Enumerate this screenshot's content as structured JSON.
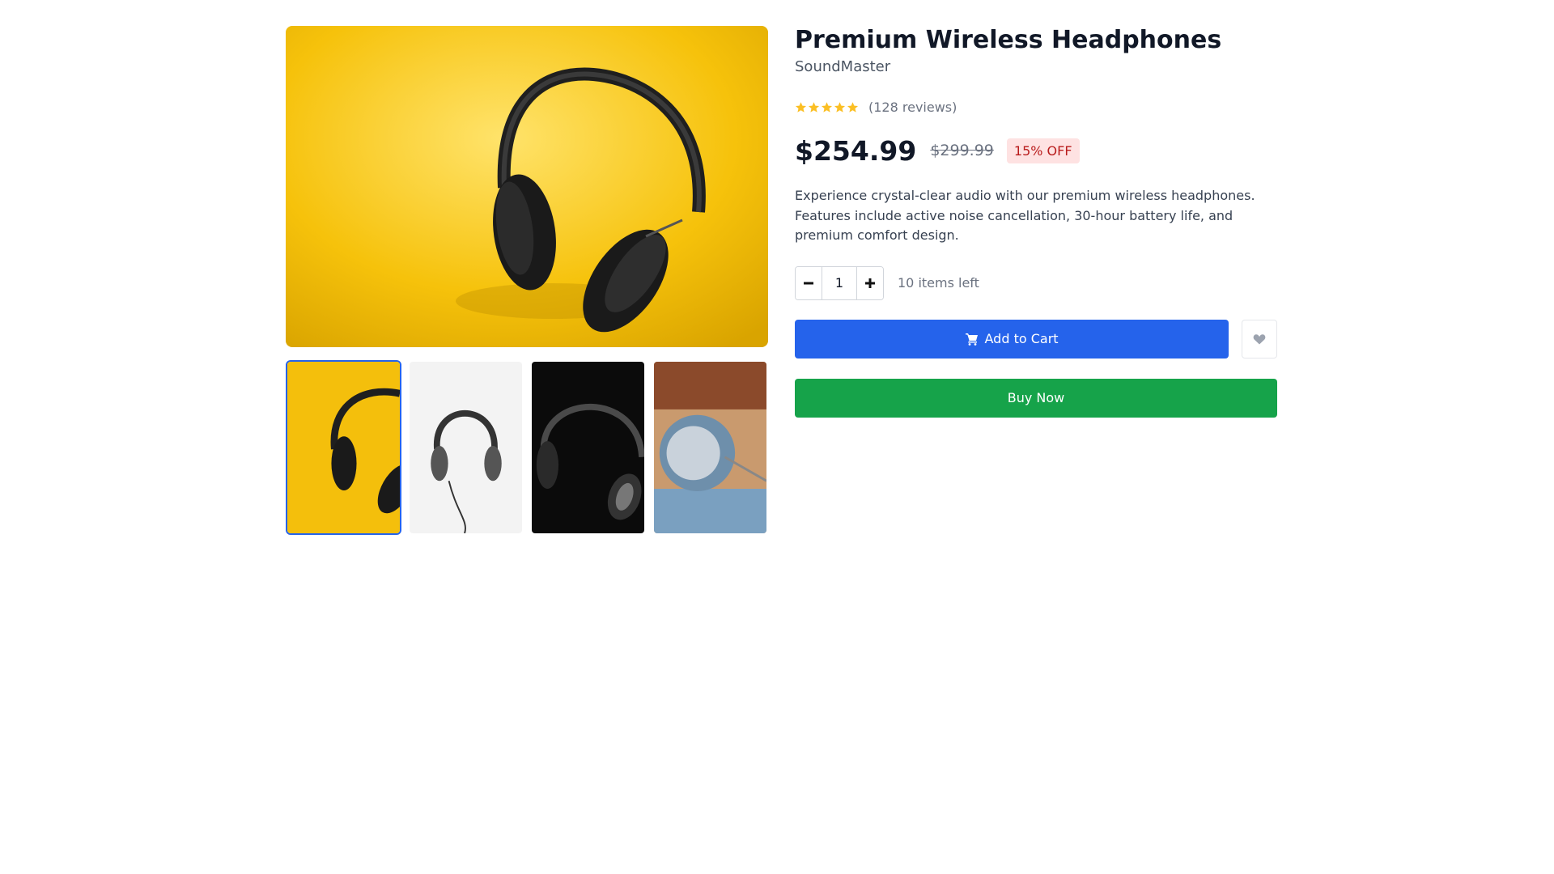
{
  "product": {
    "title": "Premium Wireless Headphones",
    "brand": "SoundMaster",
    "rating": 4.5,
    "rating_max": 5,
    "reviews_label": "(128 reviews)",
    "price": "$254.99",
    "original_price": "$299.99",
    "discount_label": "15% OFF",
    "description": "Experience crystal-clear audio with our premium wireless headphones. Features include active noise cancellation, 30-hour battery life, and premium comfort design."
  },
  "quantity": {
    "value": "1",
    "stock_label": "10 items left"
  },
  "actions": {
    "add_to_cart_label": "Add to Cart",
    "buy_now_label": "Buy Now"
  },
  "gallery": {
    "selected_index": 0,
    "thumbnails": [
      "headphones-on-yellow",
      "headphones-on-white",
      "headphones-on-black",
      "earbud-closeup"
    ]
  },
  "colors": {
    "primary": "#2563eb",
    "success": "#16a34a",
    "star": "#fbbf24",
    "discount_bg": "#fee2e2",
    "discount_text": "#b91c1c"
  }
}
